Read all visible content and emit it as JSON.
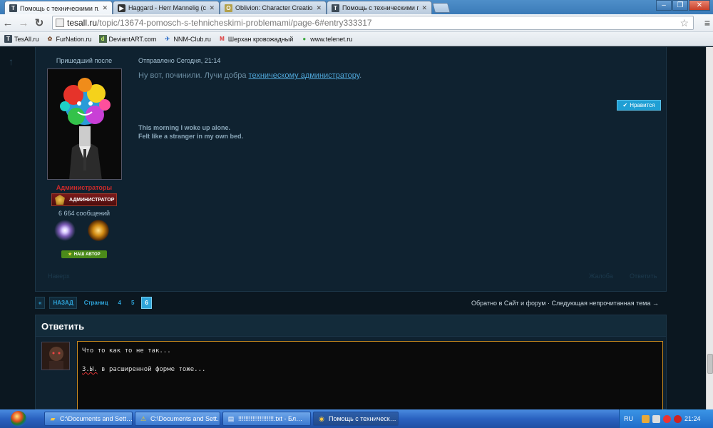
{
  "browser": {
    "tabs": [
      {
        "title": "Помощь с техническими п…",
        "favicon": "tesall-icon",
        "active": true
      },
      {
        "title": "Haggard - Herr Mannelig (c…",
        "favicon": "play-icon",
        "active": false
      },
      {
        "title": "Oblivion: Character Creation…",
        "favicon": "oblivion-icon",
        "active": false
      },
      {
        "title": "Помощь с техническими п…",
        "favicon": "tesall-icon",
        "active": false
      }
    ],
    "url_host": "tesall.ru",
    "url_rest": "/topic/13674-pomosch-s-tehnicheskimi-problemami/page-6#entry333317",
    "bookmarks": [
      {
        "label": "TesAll.ru",
        "icon": "tesall-icon"
      },
      {
        "label": "FurNation.ru",
        "icon": "paw-icon"
      },
      {
        "label": "DeviantART.com",
        "icon": "deviantart-icon"
      },
      {
        "label": "NNM-Club.ru",
        "icon": "nnm-icon"
      },
      {
        "label": "Шерхан кровожадный",
        "icon": "gmail-icon"
      },
      {
        "label": "www.telenet.ru",
        "icon": "telenet-icon"
      }
    ]
  },
  "post": {
    "author_label": "Пришедший после",
    "group": "Администраторы",
    "rank": "АДМИНИСТРАТОР",
    "message_count": "6 664 сообщений",
    "author_badge": "НАШ АВТОР",
    "meta": "Отправлено Сегодня, 21:14",
    "body_text": "Ну вот, починили. Лучи добра ",
    "body_link": "техническому администратору",
    "body_end": ".",
    "like_label": "Нравится",
    "signature_line1": "This morning I woke up alone.",
    "signature_line2": "Felt like a stranger in my own bed.",
    "reply_label": "Наверх",
    "complain_label": "Жалоба",
    "answer_label": "Ответить"
  },
  "pager": {
    "first": "«",
    "back": "НАЗАД",
    "pages_label": "Страниц",
    "pages": [
      "4",
      "5",
      "6"
    ],
    "current_page": "6",
    "back_to": "Обратно в Сайт и форум · Следующая непрочитанная тема →"
  },
  "reply": {
    "heading": "Ответить",
    "line1": "Что то как то не так...",
    "line2_prefix": "З.Ы.",
    "line2_rest": " в расширенной форме тоже..."
  },
  "taskbar": {
    "tasks": [
      {
        "label": "C:\\Documents and Sett…",
        "icon": "folder-icon"
      },
      {
        "label": "C:\\Documents and Sett…",
        "icon": "warning-icon"
      },
      {
        "label": "!!!!!!!!!!!!!!!!!!!!.txt - Бл…",
        "icon": "notepad-icon"
      },
      {
        "label": "Помощь с техническ…",
        "icon": "chrome-icon"
      }
    ],
    "lang": "RU",
    "time": "21:24"
  }
}
